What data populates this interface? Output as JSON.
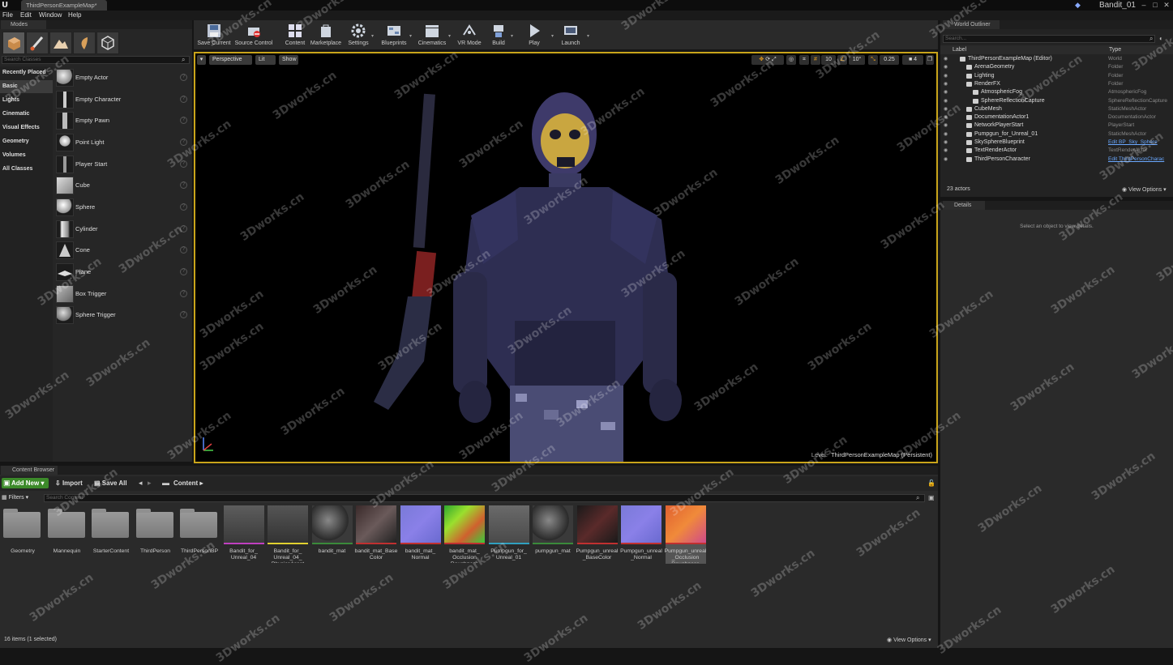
{
  "titlebar": {
    "document_tab": "ThirdPersonExampleMap*",
    "project_name": "Bandit_01",
    "window_buttons": [
      "–",
      "□",
      "✕"
    ]
  },
  "menu": [
    "File",
    "Edit",
    "Window",
    "Help"
  ],
  "modes": {
    "tab_label": "Modes",
    "search_placeholder": "Search Classes",
    "categories": [
      "Recently Placed",
      "Basic",
      "Lights",
      "Cinematic",
      "Visual Effects",
      "Geometry",
      "Volumes",
      "All Classes"
    ],
    "selected_category": "Basic",
    "items": [
      "Empty Actor",
      "Empty Character",
      "Empty Pawn",
      "Point Light",
      "Player Start",
      "Cube",
      "Sphere",
      "Cylinder",
      "Cone",
      "Plane",
      "Box Trigger",
      "Sphere Trigger"
    ]
  },
  "toolbar": {
    "buttons": [
      "Save Current",
      "Source Control",
      "Content",
      "Marketplace",
      "Settings",
      "Blueprints",
      "Cinematics",
      "VR Mode",
      "Build",
      "Play",
      "Launch"
    ]
  },
  "viewport": {
    "view_mode": "Perspective",
    "lighting": "Lit",
    "show": "Show",
    "grid_snap": "10",
    "rotation_snap": "10°",
    "scale_snap": "0.25",
    "camera_speed": "4",
    "level_key": "Level:",
    "level_value": "ThirdPersonExampleMap (Persistent)"
  },
  "outliner": {
    "tab_label": "World Outliner",
    "search_placeholder": "Search...",
    "col_label": "Label",
    "col_type": "Type",
    "rows": [
      {
        "label": "ThirdPersonExampleMap (Editor)",
        "type": "World",
        "indent": 0,
        "link": false
      },
      {
        "label": "ArenaGeometry",
        "type": "Folder",
        "indent": 1,
        "link": false
      },
      {
        "label": "Lighting",
        "type": "Folder",
        "indent": 1,
        "link": false
      },
      {
        "label": "RenderFX",
        "type": "Folder",
        "indent": 1,
        "link": false
      },
      {
        "label": "AtmosphericFog",
        "type": "AtmosphericFog",
        "indent": 2,
        "link": false
      },
      {
        "label": "SphereReflectionCapture",
        "type": "SphereReflectionCapture",
        "indent": 2,
        "link": false
      },
      {
        "label": "CubeMesh",
        "type": "StaticMeshActor",
        "indent": 1,
        "link": false
      },
      {
        "label": "DocumentationActor1",
        "type": "DocumentationActor",
        "indent": 1,
        "link": false
      },
      {
        "label": "NetworkPlayerStart",
        "type": "PlayerStart",
        "indent": 1,
        "link": false
      },
      {
        "label": "Pumpgun_for_Unreal_01",
        "type": "StaticMeshActor",
        "indent": 1,
        "link": false
      },
      {
        "label": "SkySphereBlueprint",
        "type": "Edit BP_Sky_Sphere",
        "indent": 1,
        "link": true
      },
      {
        "label": "TextRenderActor",
        "type": "TextRenderActor",
        "indent": 1,
        "link": false
      },
      {
        "label": "ThirdPersonCharacter",
        "type": "Edit ThirdPersonCharac",
        "indent": 1,
        "link": true
      }
    ],
    "actor_count": "23 actors",
    "view_options": "View Options"
  },
  "details": {
    "tab_label": "Details",
    "message": "Select an object to view details."
  },
  "content_browser": {
    "tab_label": "Content Browser",
    "add_new": "Add New",
    "import": "Import",
    "save_all": "Save All",
    "path": "Content",
    "filters": "Filters",
    "search_placeholder": "Search Content",
    "assets": [
      {
        "label": "Geometry",
        "kind": "folder"
      },
      {
        "label": "Mannequin",
        "kind": "folder"
      },
      {
        "label": "StarterContent",
        "kind": "folder"
      },
      {
        "label": "ThirdPerson",
        "kind": "folder"
      },
      {
        "label": "ThirdPersonBP",
        "kind": "folder"
      },
      {
        "label": "Bandit_for_ Unreal_04",
        "kind": "mesh"
      },
      {
        "label": "Bandit_for_ Unreal_04_ PhysicsAsset",
        "kind": "physics"
      },
      {
        "label": "bandit_mat",
        "kind": "material"
      },
      {
        "label": "bandit_mat_Base Color",
        "kind": "texture-base"
      },
      {
        "label": "bandit_mat_ Normal",
        "kind": "texture-normal"
      },
      {
        "label": "bandit_mat_ Occlusion Roughness",
        "kind": "texture-orm"
      },
      {
        "label": "Pumpgun_for_ Unreal_01",
        "kind": "gun"
      },
      {
        "label": "pumpgun_mat",
        "kind": "material"
      },
      {
        "label": "Pumpgun_unreal _BaseColor",
        "kind": "texture-gunbase"
      },
      {
        "label": "Pumpgun_unreal _Normal",
        "kind": "texture-normal"
      },
      {
        "label": "Pumpgun_unreal _Occlusion Roughness",
        "kind": "texture-orm2"
      }
    ],
    "status": "16 items (1 selected)",
    "view_options": "View Options"
  },
  "watermark": "3Dworks.cn"
}
